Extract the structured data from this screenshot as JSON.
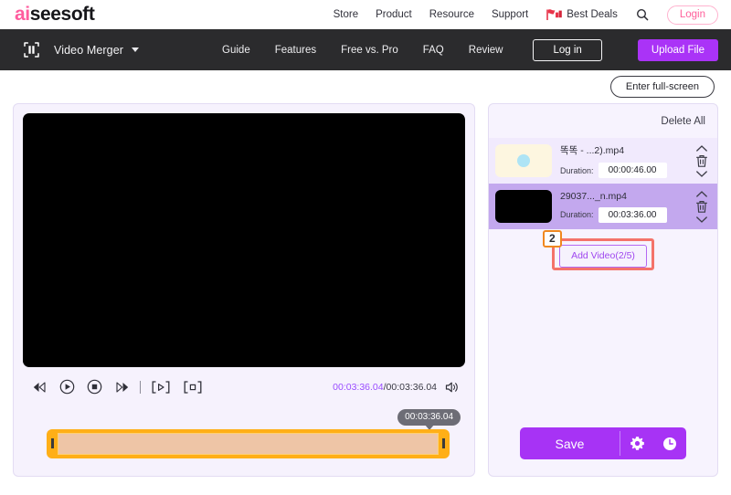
{
  "brand": {
    "logo_a": "ai",
    "logo_b": "seesoft",
    "nav": [
      {
        "label": "Store",
        "name": "store"
      },
      {
        "label": "Product",
        "name": "product"
      },
      {
        "label": "Resource",
        "name": "resource"
      },
      {
        "label": "Support",
        "name": "support"
      }
    ],
    "deals_label": "Best Deals",
    "deals_icon": "deals-flag-icon",
    "search_icon": "search-icon",
    "login_label": "Login"
  },
  "appbar": {
    "app_icon": "video-merger-icon",
    "app_title": "Video Merger",
    "caret_icon": "chevron-down-icon",
    "nav": [
      {
        "label": "Guide",
        "name": "guide"
      },
      {
        "label": "Features",
        "name": "features"
      },
      {
        "label": "Free vs. Pro",
        "name": "free-vs-pro"
      },
      {
        "label": "FAQ",
        "name": "faq"
      },
      {
        "label": "Review",
        "name": "review"
      }
    ],
    "login_label": "Log in",
    "upload_label": "Upload File"
  },
  "stage": {
    "fullscreen_label": "Enter full-screen"
  },
  "player": {
    "controls": [
      {
        "name": "rewind-button",
        "icon": "rewind-icon"
      },
      {
        "name": "play-button",
        "icon": "play-circle-icon"
      },
      {
        "name": "stop-button",
        "icon": "stop-circle-icon"
      },
      {
        "name": "fast-forward-button",
        "icon": "fast-forward-icon"
      }
    ],
    "mark_controls": [
      {
        "name": "set-start-point-button",
        "icon": "bracket-play-icon"
      },
      {
        "name": "set-end-point-button",
        "icon": "bracket-stop-icon"
      }
    ],
    "current_time": "00:03:36.04",
    "time_separator": "/",
    "total_time": "00:03:36.04",
    "volume_icon": "volume-icon",
    "tooltip_time": "00:03:36.04"
  },
  "list": {
    "delete_all_label": "Delete All",
    "duration_label": "Duration:",
    "items": [
      {
        "filename": "똑똑 - ...2).mp4",
        "duration": "00:00:46.00",
        "thumb_kind": "cream-dot",
        "selected": false
      },
      {
        "filename": "29037..._n.mp4",
        "duration": "00:03:36.00",
        "thumb_kind": "black",
        "selected": true
      }
    ],
    "move_up_icon": "chevron-up-icon",
    "delete_icon": "trash-icon",
    "move_down_icon": "chevron-down-icon",
    "add_video_label": "Add Video(2/5)",
    "step_badge": "2",
    "save_label": "Save",
    "settings_icon": "gear-icon",
    "history_icon": "clock-icon"
  },
  "colors": {
    "accent_purple": "#a733f5",
    "brand_pink": "#ff5f9a",
    "highlight_red": "#f4736a",
    "badge_orange": "#f0881f",
    "timeline_orange": "#ffaf17",
    "selected_row": "#c3a8ee",
    "panel_bg": "#f6f2fd"
  }
}
